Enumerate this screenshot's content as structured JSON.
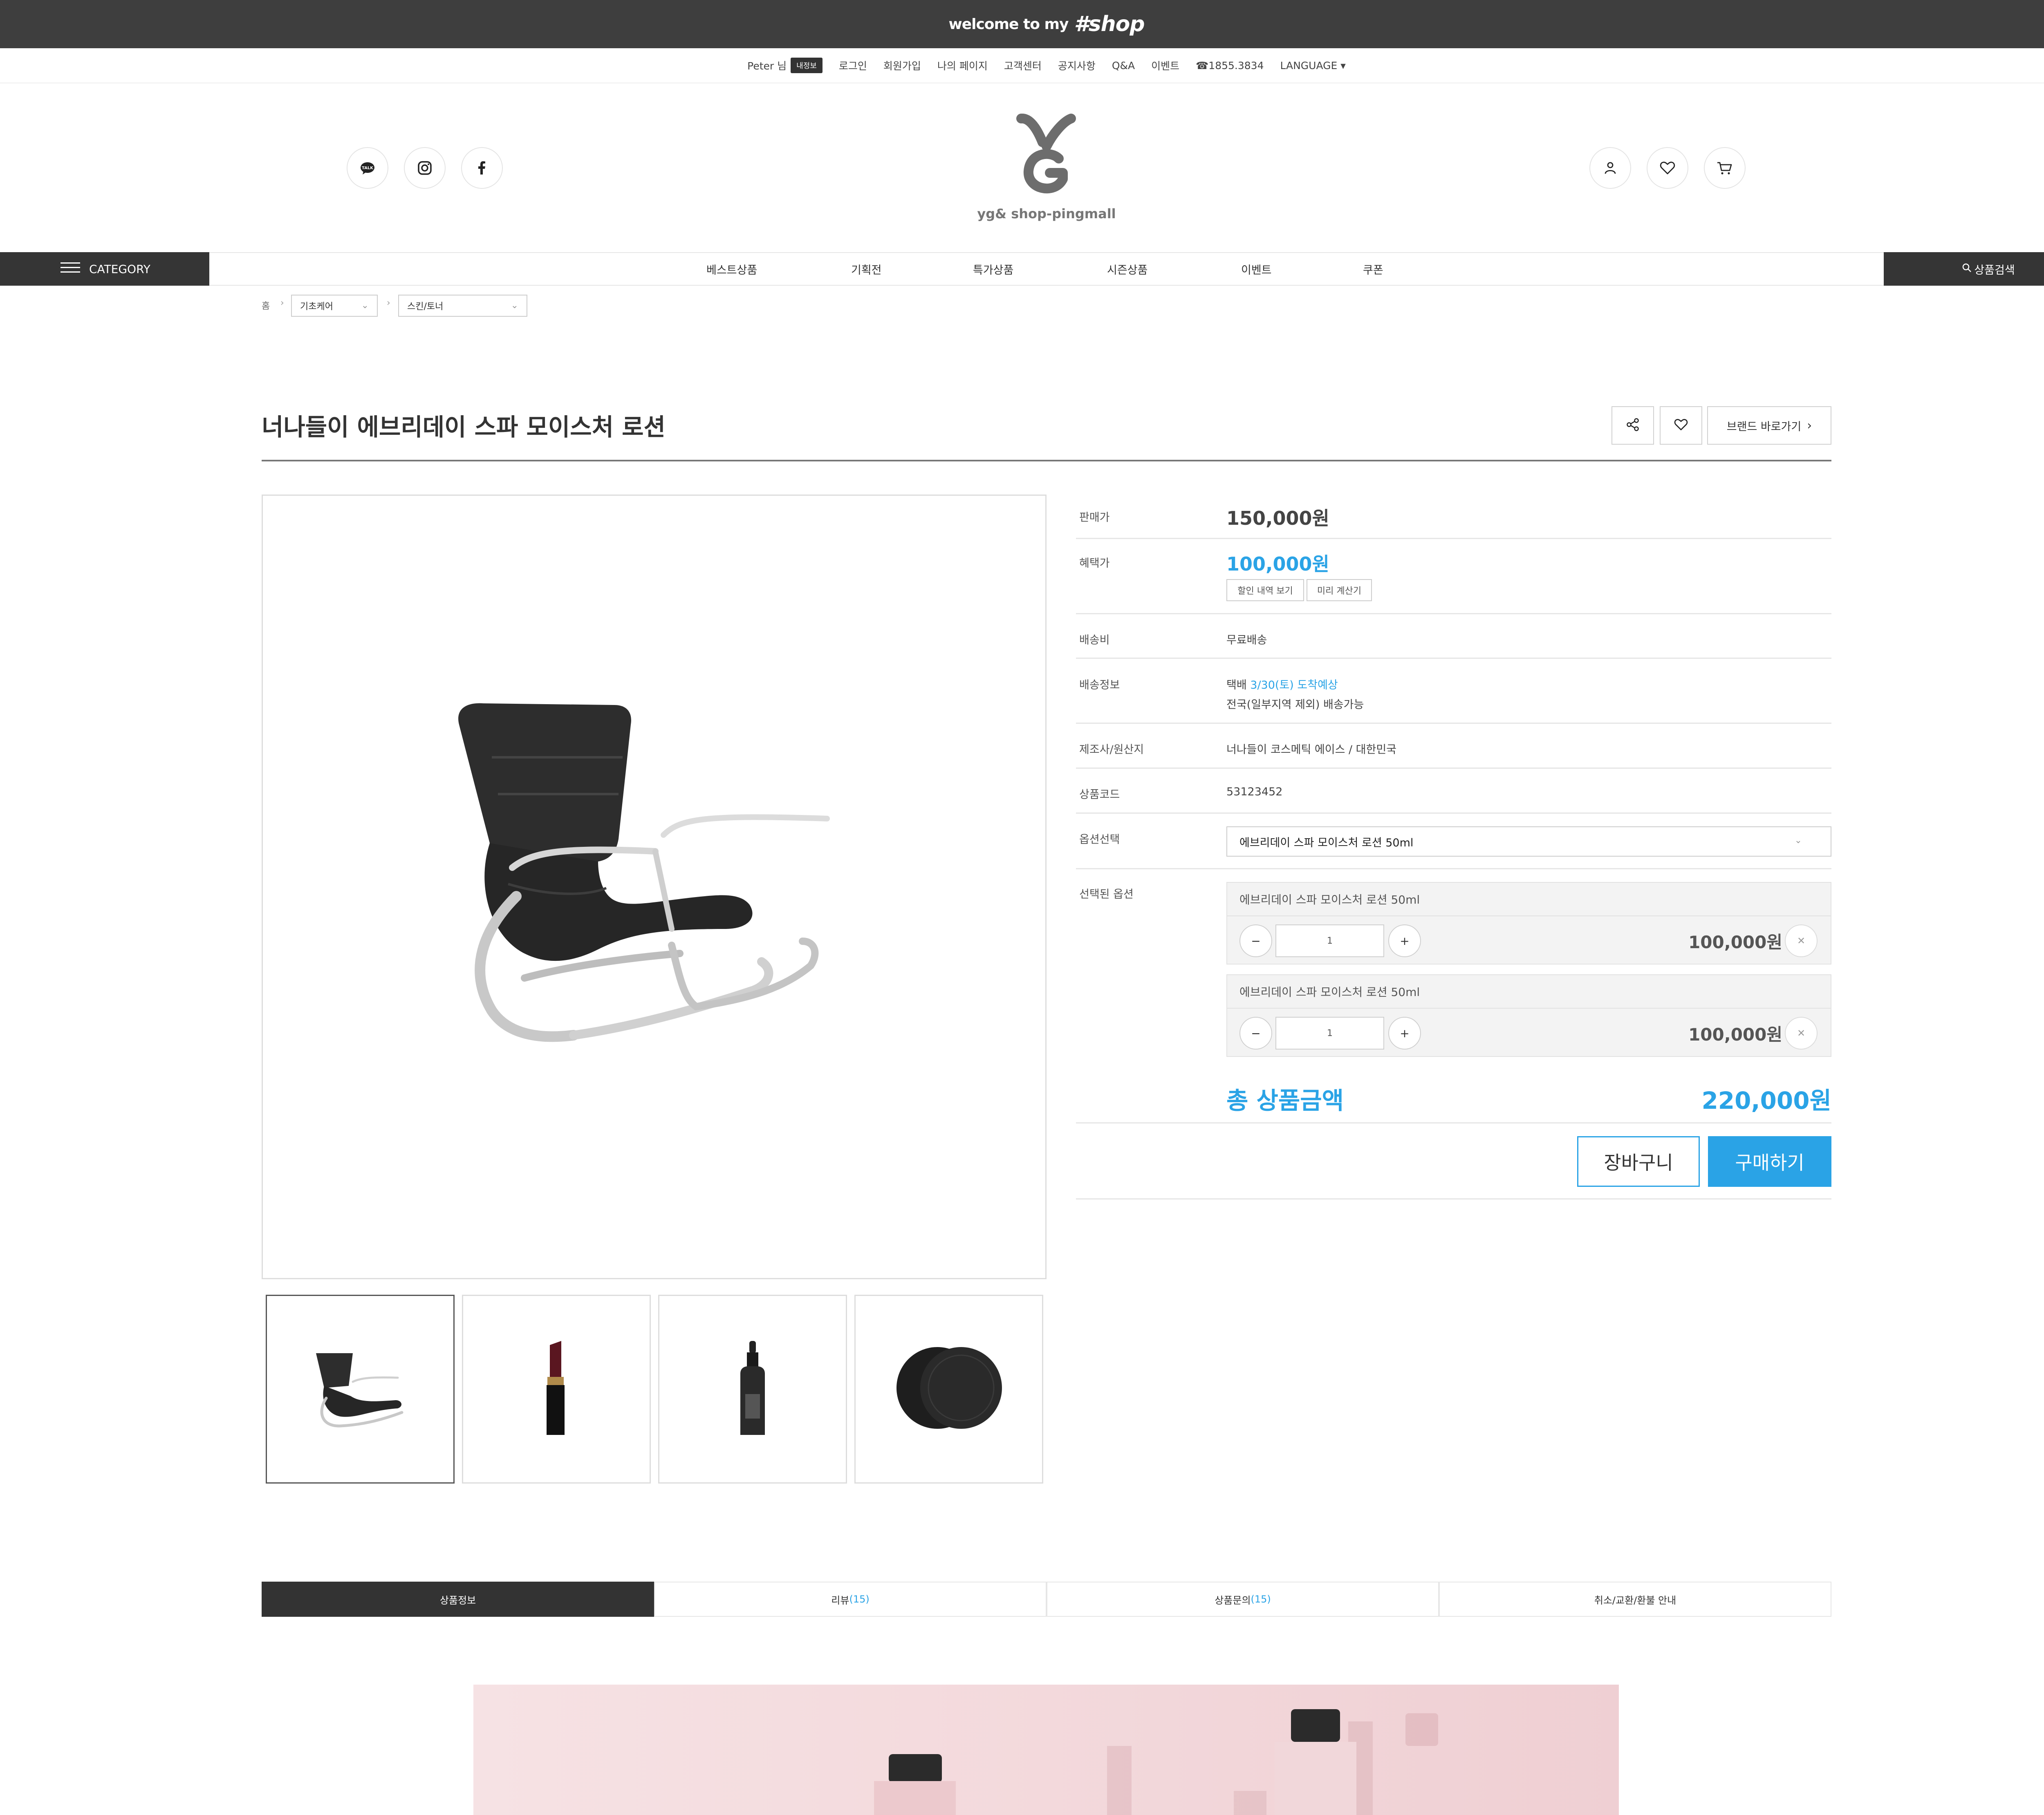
{
  "banner": {
    "welcome": "welcome to my",
    "shop": "#shop"
  },
  "util": {
    "user": "Peter 님",
    "badge": "내정보",
    "links": [
      "로그인",
      "회원가입",
      "나의 페이지",
      "고객센터",
      "공지사항",
      "Q&A",
      "이벤트"
    ],
    "phone": "☎1855.3834",
    "language": "LANGUAGE ▾"
  },
  "header": {
    "logo_text": "yg& shop-pingmall"
  },
  "nav": {
    "category": "CATEGORY",
    "items": [
      "베스트상품",
      "기획전",
      "특가상품",
      "시즌상품",
      "이벤트",
      "쿠폰"
    ],
    "search": "상품검색"
  },
  "breadcrumb": {
    "home": "홈",
    "level1": "기초케어",
    "level2": "스킨/토너"
  },
  "product": {
    "title": "너나들이 에브리데이 스파 모이스처 로션",
    "brand_button": "브랜드 바로가기"
  },
  "info": {
    "price_label": "판매가",
    "price": "150,000원",
    "benefit_label": "혜택가",
    "benefit_price": "100,000원",
    "discount_btn": "할인 내역 보기",
    "calc_btn": "미리 계산기",
    "shipping_label": "배송비",
    "shipping": "무료배송",
    "delivery_label": "배송정보",
    "delivery_prefix": "택배",
    "delivery_date": "3/30(토) 도착예상",
    "delivery_note": "전국(일부지역 제외) 배송가능",
    "maker_label": "제조사/원산지",
    "maker": "너나들이 코스메틱 에이스 / 대한민국",
    "code_label": "상품코드",
    "code": "53123452",
    "option_label": "옵션선택",
    "option_value": "에브리데이 스파 모이스처 로션 50ml",
    "selected_label": "선택된 옵션"
  },
  "selected_options": [
    {
      "name": "에브리데이 스파 모이스처 로션 50ml",
      "qty": "1",
      "price": "100,000원"
    },
    {
      "name": "에브리데이 스파 모이스처 로션 50ml",
      "qty": "1",
      "price": "100,000원"
    }
  ],
  "total": {
    "label": "총 상품금액",
    "value": "220,000원"
  },
  "buttons": {
    "cart": "장바구니",
    "buy": "구매하기"
  },
  "tabs": [
    {
      "label": "상품정보",
      "count": ""
    },
    {
      "label": "리뷰",
      "count": "(15)"
    },
    {
      "label": "상품문의",
      "count": "(15)"
    },
    {
      "label": "취소/교환/환불 안내",
      "count": ""
    }
  ],
  "colors": {
    "accent": "#2aa3e6",
    "dark": "#353535",
    "banner": "#3e3e3e"
  }
}
